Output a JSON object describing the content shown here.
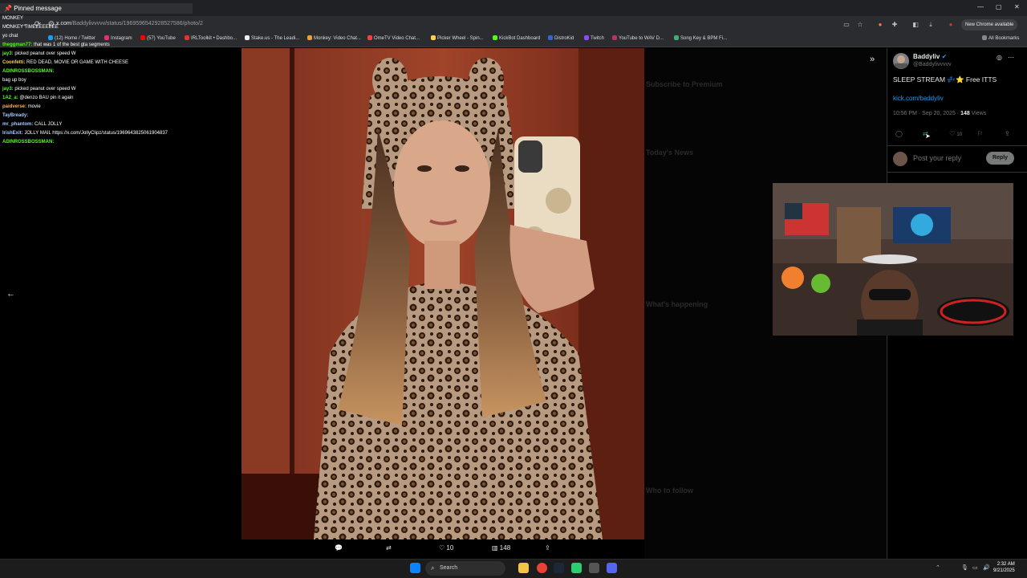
{
  "browser": {
    "url_host": "x.com",
    "url_path": "/Baddylivvvvv/status/1969596542928527586/photo/2",
    "new_chrome_label": "New Chrome available",
    "all_bookmarks_label": "All Bookmarks",
    "bookmarks": [
      {
        "label": "(12) Home / Twitter",
        "color": "#1d9bf0"
      },
      {
        "label": "Instagram",
        "color": "#e1306c"
      },
      {
        "label": "(57) YouTube",
        "color": "#ff0000"
      },
      {
        "label": "IRLToolkit • Dashbo...",
        "color": "#d33"
      },
      {
        "label": "Stake.us - The Leadi...",
        "color": "#eee"
      },
      {
        "label": "Monkey: Video Chat...",
        "color": "#f0a030"
      },
      {
        "label": "OmeTV Video Chat...",
        "color": "#e44"
      },
      {
        "label": "Picker Wheel - Spin...",
        "color": "#ffd23f"
      },
      {
        "label": "KickBot Dashboard",
        "color": "#53fc18"
      },
      {
        "label": "DistroKid",
        "color": "#36c"
      },
      {
        "label": "Twitch",
        "color": "#9146ff"
      },
      {
        "label": "YouTube to WAV D...",
        "color": "#b36"
      },
      {
        "label": "Song Key & BPM Fi...",
        "color": "#4a7"
      }
    ]
  },
  "chat": {
    "pinned_label": "Pinned message",
    "messages": [
      {
        "user": "",
        "text": "MONKEY",
        "color": "#e05050"
      },
      {
        "user": "",
        "text": "MONKEY TIMEEEEEEEE",
        "color": "#e05050"
      },
      {
        "user": "",
        "text": "yo chat",
        "color": "#53fc18"
      },
      {
        "user": "theggman77:",
        "text": "that was 1 of the best gta segments",
        "color": "#53fc18"
      },
      {
        "user": "jay3:",
        "text": "picked peanut over speed W",
        "color": "#53fc18"
      },
      {
        "user": "Coonfetti:",
        "text": "RED DEAD, MOVIE OR GAME WITH CHEESE",
        "color": "#ffd23f"
      },
      {
        "user": "ADINROSSBOSSMAN:",
        "text": "",
        "color": "#53fc18"
      },
      {
        "user": "",
        "text": "bag up boy",
        "color": "#e05050"
      },
      {
        "user": "jay3:",
        "text": "picked peanut over speed W",
        "color": "#53fc18"
      },
      {
        "user": "1A2_a:",
        "text": "@denzo BAU pin it again",
        "color": "#53fc18"
      },
      {
        "user": "paidverse:",
        "text": "movie",
        "color": "#ffb347"
      },
      {
        "user": "TayBready:",
        "text": "",
        "color": "#a8c8ff"
      },
      {
        "user": "mr_phantom:",
        "text": "CALL JOLLY",
        "color": "#a8c8ff"
      },
      {
        "user": "IrishExit:",
        "text": "JOLLY MAIL https://x.com/JollyClipz/status/1969643825061904837",
        "color": "#a8c8ff"
      },
      {
        "user": "ADINROSSBOSSMAN:",
        "text": "",
        "color": "#53fc18"
      }
    ]
  },
  "photo_actions": {
    "likes": "10",
    "views": "148"
  },
  "tweet": {
    "display_name": "Baddyliv",
    "handle": "@Baddylivvvvv",
    "text": "SLEEP STREAM 💤⭐ Free ITTS",
    "link": "kick.com/baddyliv",
    "time": "10:56 PM · Sep 20, 2025 ·",
    "views_count": "148",
    "views_label": "Views",
    "likes": "10",
    "reply_placeholder": "Post your reply",
    "reply_button": "Reply"
  },
  "background_ghost": {
    "follow_label": "Subscribe to Premium",
    "news_label": "Today's News",
    "happening_label": "What's happening",
    "who_to_follow": "Who to follow"
  },
  "taskbar": {
    "search_label": "Search",
    "time": "2:32 AM",
    "date": "9/21/2025"
  }
}
